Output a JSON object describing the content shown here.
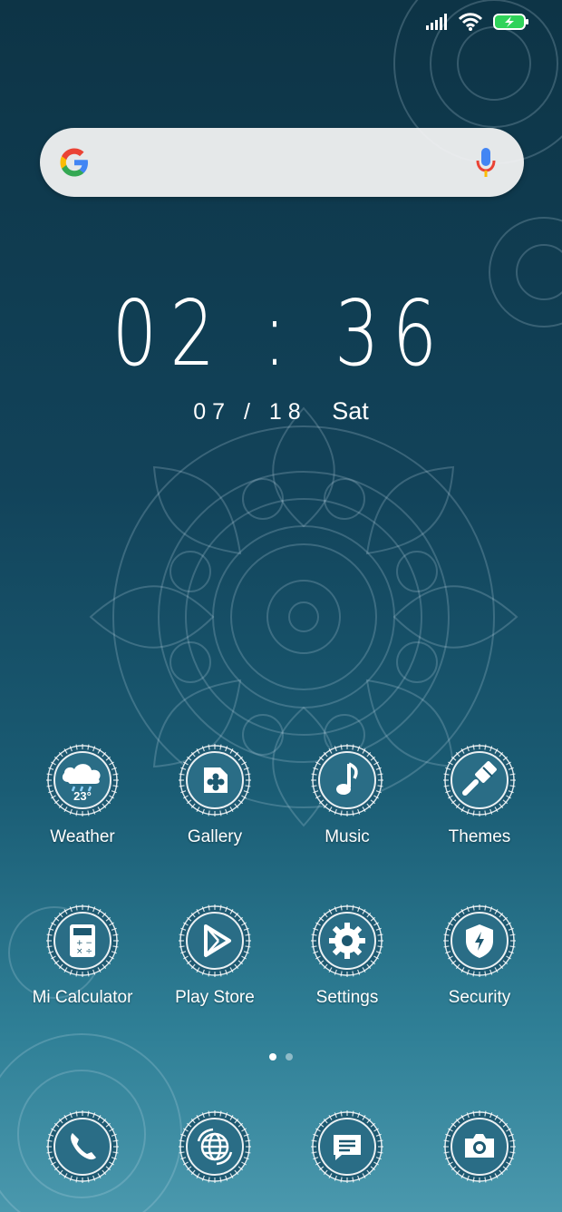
{
  "status_bar": {
    "signal": "signal-icon",
    "wifi": "wifi-icon",
    "battery": "battery-charging-icon"
  },
  "search": {
    "logo": "google-logo",
    "mic": "mic-icon"
  },
  "clock": {
    "time": "02 : 36",
    "date": "07 / 18",
    "weekday": "Sat"
  },
  "apps_row1": [
    {
      "label": "Weather",
      "icon": "weather-cloud-icon",
      "temp": "23°"
    },
    {
      "label": "Gallery",
      "icon": "gallery-icon"
    },
    {
      "label": "Music",
      "icon": "music-note-icon"
    },
    {
      "label": "Themes",
      "icon": "paintbrush-icon"
    }
  ],
  "apps_row2": [
    {
      "label": "Mi Calculator",
      "icon": "calculator-icon"
    },
    {
      "label": "Play Store",
      "icon": "play-store-icon"
    },
    {
      "label": "Settings",
      "icon": "gear-icon"
    },
    {
      "label": "Security",
      "icon": "shield-icon"
    }
  ],
  "dock": [
    {
      "icon": "phone-icon"
    },
    {
      "icon": "browser-globe-icon"
    },
    {
      "icon": "messages-icon"
    },
    {
      "icon": "camera-icon"
    }
  ],
  "pager": {
    "pages": 2,
    "active": 1
  },
  "colors": {
    "bg_top": "#0d3446",
    "bg_bottom": "#4a98ad",
    "icon_fill": "#1d5870",
    "accent": "#ffffff"
  }
}
